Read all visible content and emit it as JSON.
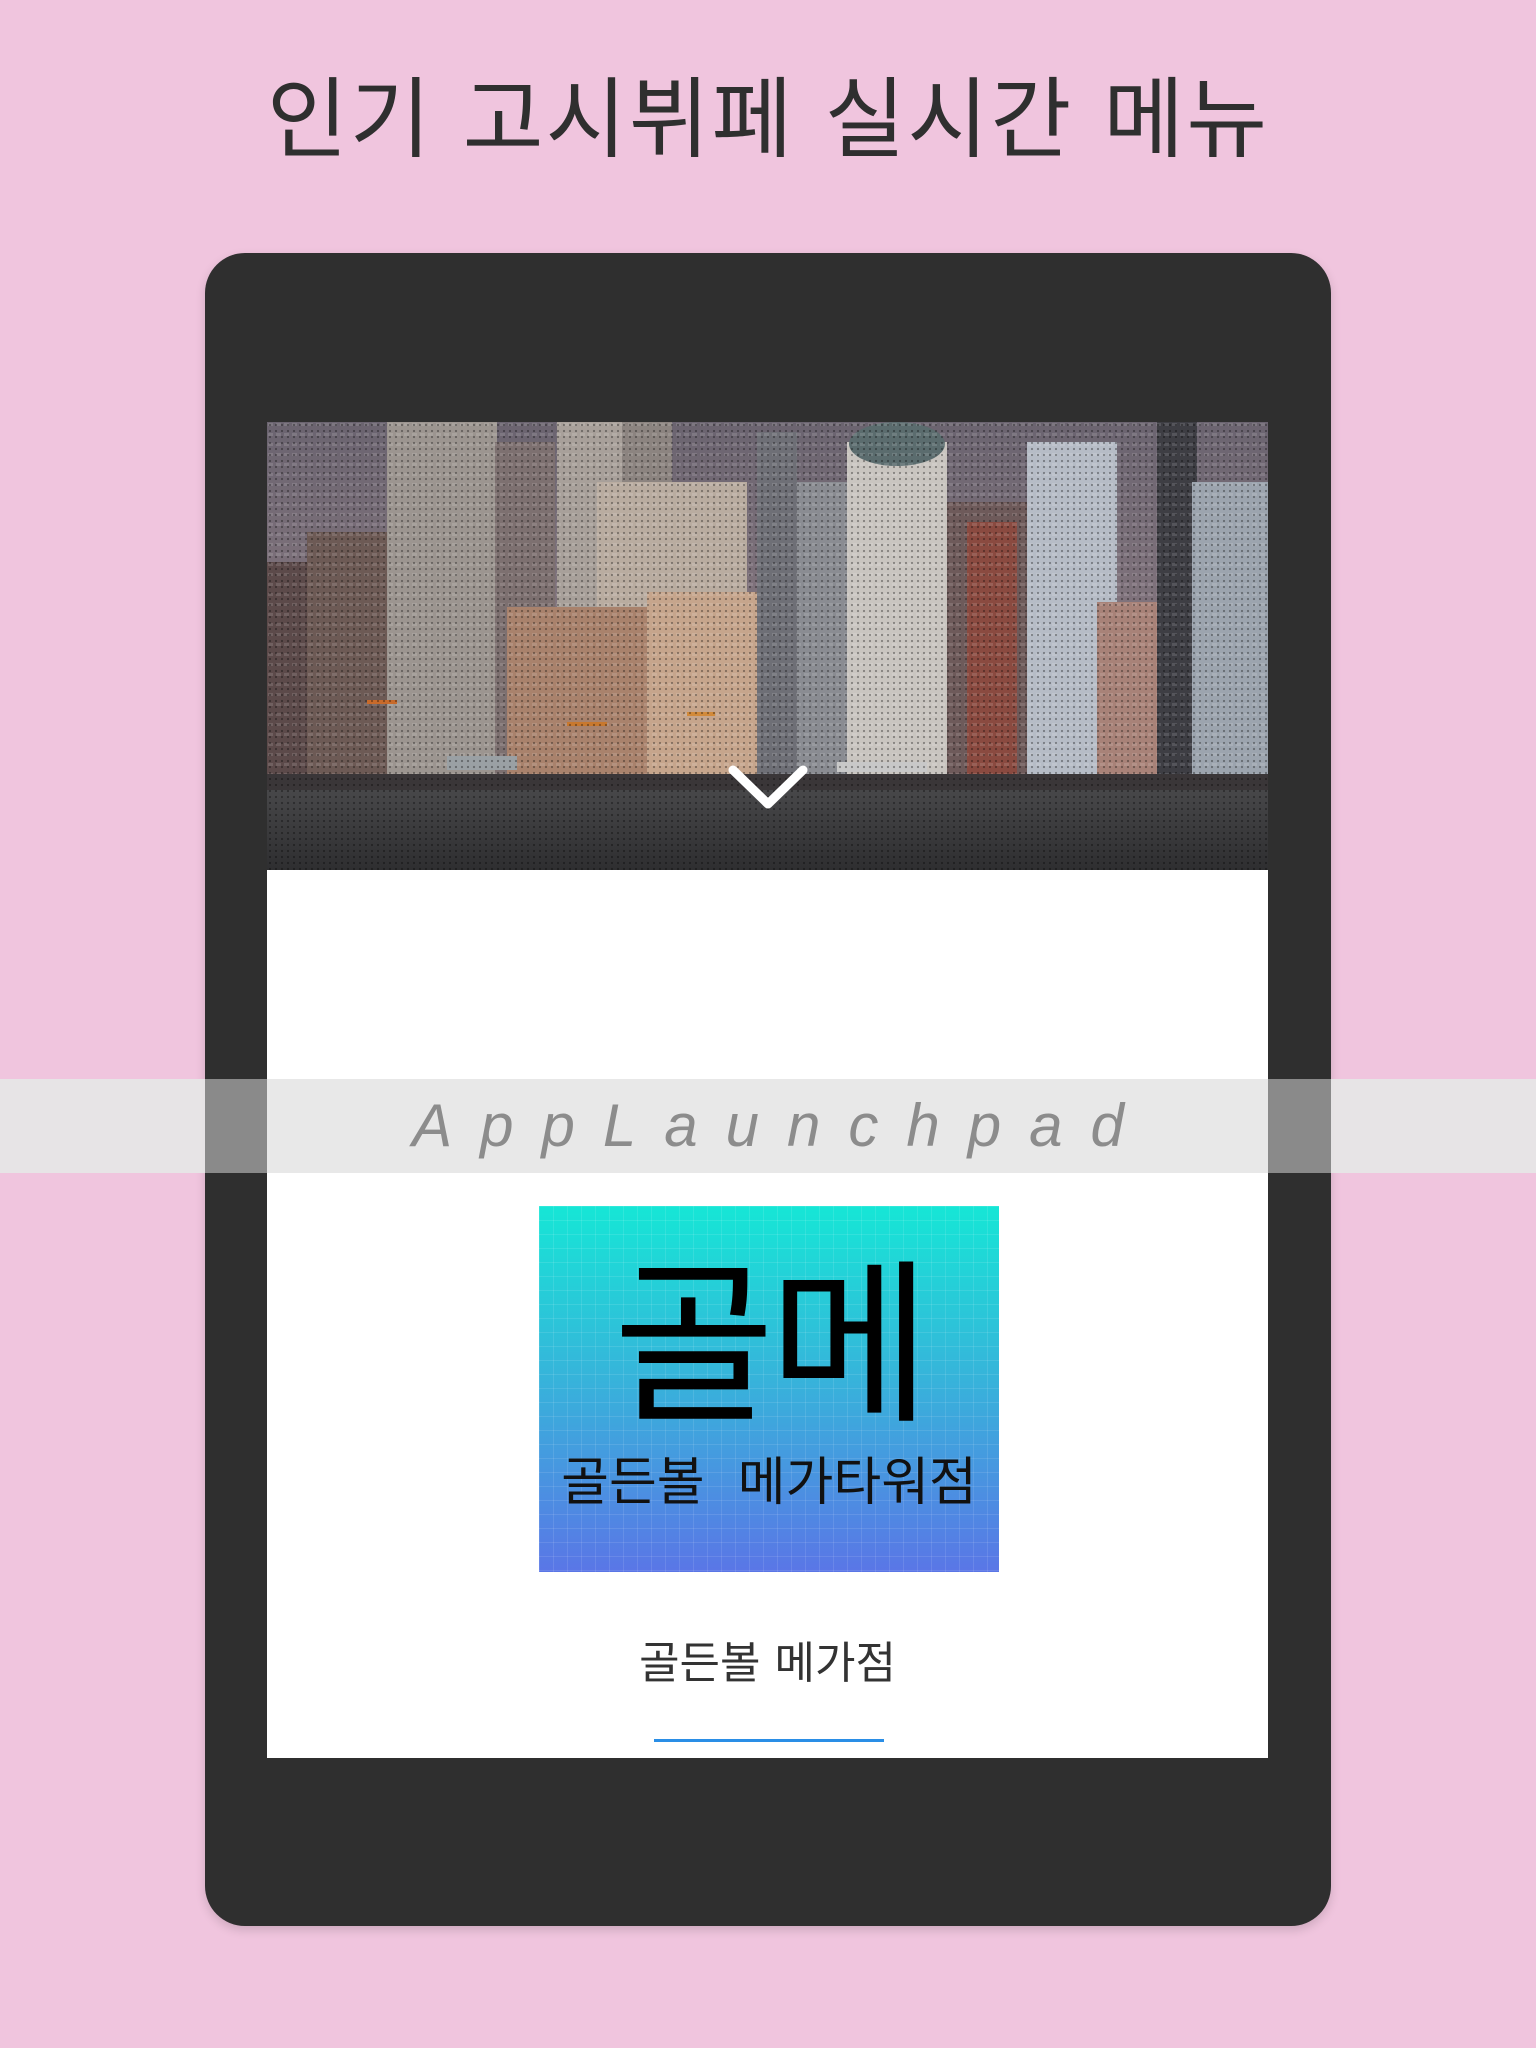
{
  "headline": "인기 고시뷔페 실시간 메뉴",
  "hero": {
    "image": "city-skyline-waterfront",
    "scroll_icon": "chevron-down-icon"
  },
  "logo": {
    "big": "골메",
    "small": "골든볼  메가타워점",
    "colors": [
      "#16e6d6",
      "#5a76e6"
    ]
  },
  "store": {
    "name": "골든볼 메가점",
    "accent": "#2a8ee6"
  },
  "watermark": {
    "text": "AppLaunchpad"
  }
}
